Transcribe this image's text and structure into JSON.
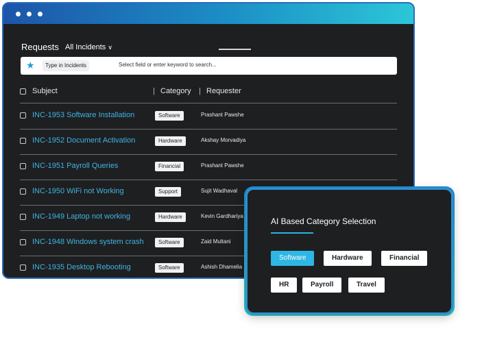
{
  "requests": {
    "title": "Requests",
    "filter_label": "All Incidents",
    "search": {
      "chip": "Type in Incidents",
      "hint": "Select field or enter keyword to search..."
    },
    "columns": [
      "Subject",
      "Category",
      "Requester"
    ],
    "rows": [
      {
        "subject": "INC-1953 Software Installation",
        "category": "Software",
        "requester": "Prashant Pawshe"
      },
      {
        "subject": "INC-1952 Document Activation",
        "category": "Hardware",
        "requester": "Akshay Morvadiya"
      },
      {
        "subject": "INC-1951 Payroll Queries",
        "category": "Financial",
        "requester": "Prashant Pawshe"
      },
      {
        "subject": "INC-1950  WiFi not Working",
        "category": "Support",
        "requester": "Sujit Wadhaval"
      },
      {
        "subject": "INC-1949 Laptop not working",
        "category": "Hardware",
        "requester": "Kevin Gardhariya"
      },
      {
        "subject": "INC-1948 Windows system crash",
        "category": "Software",
        "requester": "Zaid Multani"
      },
      {
        "subject": "INC-1935 Desktop Rebooting",
        "category": "Software",
        "requester": "Ashish Dhamelia"
      }
    ]
  },
  "panel": {
    "title": "AI Based Category Selection",
    "options": [
      "Software",
      "Hardware",
      "Financial",
      "HR",
      "Payroll",
      "Travel"
    ],
    "selected": "Software"
  },
  "colors": {
    "accent": "#2eb6e4",
    "link": "#3fb5e3",
    "dark_bg": "#1e1f21",
    "window_gradient_start": "#1d55a8",
    "window_gradient_end": "#2cc6d8"
  },
  "icons": {
    "search_prefix": "star-icon",
    "dropdown": "chevron-down-icon"
  }
}
